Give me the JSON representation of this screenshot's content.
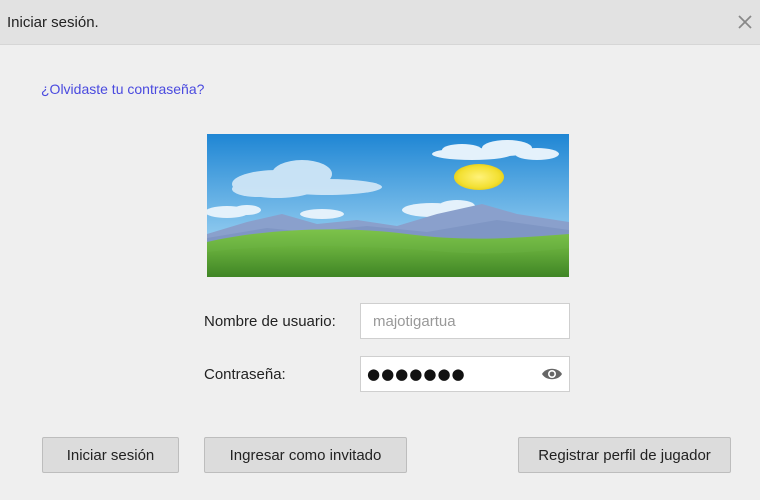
{
  "dialog": {
    "title": "Iniciar sesión.",
    "close_icon": "close-icon"
  },
  "forgot_password": "¿Olvidaste tu contraseña?",
  "banner": {
    "icon": "landscape-banner",
    "colors": {
      "sky": "#2a8bd6",
      "sun": "#f4e33a",
      "grass": "#5ea83a"
    }
  },
  "form": {
    "username_label": "Nombre de usuario:",
    "username_value": "majotigartua",
    "password_label": "Contraseña:",
    "password_masked": "●●●●●●●",
    "show_password_icon": "eye-icon"
  },
  "buttons": {
    "login": "Iniciar sesión",
    "guest": "Ingresar como invitado",
    "register": "Registrar perfil de jugador"
  },
  "colors": {
    "link": "#4a4adf",
    "background": "#efefef",
    "titlebar": "#e2e2e2"
  }
}
